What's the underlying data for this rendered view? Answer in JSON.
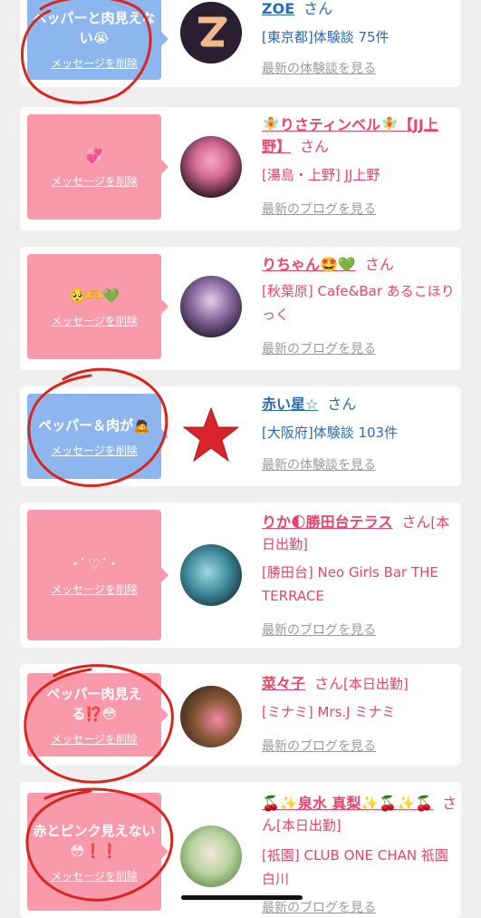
{
  "common": {
    "delete_label": "メッセージを削除",
    "san": "さん"
  },
  "cards": [
    {
      "message": "ペッパーと肉見えない😭",
      "name": "ZOE",
      "info": "[東京都]体験談 75件",
      "link": "最新の体験談を見る"
    },
    {
      "message": "💞",
      "name": "🧚りさティンベル🧚【JJ上野】",
      "info": "[湯島・上野] JJ上野",
      "link": "最新のブログを見る"
    },
    {
      "message": "🥺🫶💚",
      "name": "りちゃん🤩💚",
      "info": "[秋葉原] Cafe&Bar あるこほりっく",
      "link": "最新のブログを見る"
    },
    {
      "message": "ペッパー＆肉が🙇",
      "name": "赤い星☆",
      "info": "[大阪府]体験談 103件",
      "link": "最新の体験談を見る"
    },
    {
      "message": "･ ͘ ♡ ͘ ･",
      "name": "りか🌓勝田台テラス",
      "status": "[本日出勤]",
      "info": "[勝田台] Neo Girls Bar THE TERRACE",
      "link": "最新のブログを見る"
    },
    {
      "message": "ペッパー肉見える⁉️😳",
      "name": "菜々子",
      "status": "[本日出勤]",
      "info": "[ミナミ] Mrs.J ミナミ",
      "link": "最新のブログを見る"
    },
    {
      "message": "赤とピンク見えない😳❗❗",
      "name": "🍒✨泉水 真梨✨🍒✨🍒",
      "status": "[本日出勤]",
      "info": "[祇園] CLUB ONE CHAN 祇園白川",
      "link": "最新のブログを見る"
    }
  ]
}
